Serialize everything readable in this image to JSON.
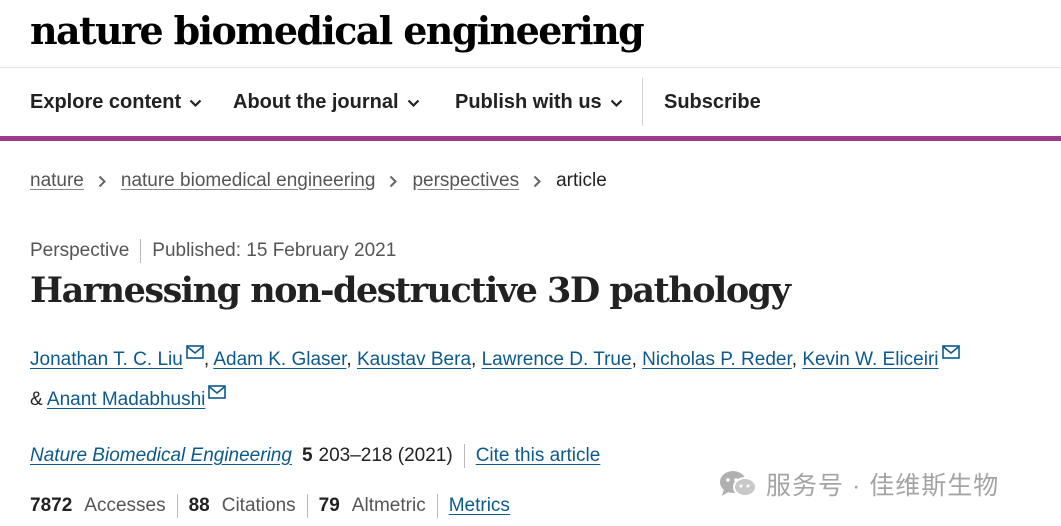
{
  "site": {
    "logo": "nature biomedical engineering"
  },
  "nav": {
    "items": [
      {
        "label": "Explore content"
      },
      {
        "label": "About the journal"
      },
      {
        "label": "Publish with us"
      }
    ],
    "subscribe": "Subscribe"
  },
  "breadcrumb": {
    "links": [
      "nature",
      "nature biomedical engineering",
      "perspectives"
    ],
    "current": "article"
  },
  "article": {
    "type": "Perspective",
    "published": "Published: 15 February 2021",
    "title": "Harnessing non-destructive 3D pathology",
    "authors": [
      "Jonathan T. C. Liu",
      "Adam K. Glaser",
      "Kaustav Bera",
      "Lawrence D. True",
      "Nicholas P. Reder",
      "Kevin W. Eliceiri",
      "Anant Madabhushi"
    ],
    "ampersand": "&",
    "journal": "Nature Biomedical Engineering",
    "volume": "5",
    "pages_year": "203–218 (2021)",
    "cite_label": "Cite this article"
  },
  "metrics": {
    "accesses_count": "7872",
    "accesses_label": "Accesses",
    "citations_count": "88",
    "citations_label": "Citations",
    "altmetric_count": "79",
    "altmetric_label": "Altmetric",
    "metrics_link": "Metrics"
  },
  "watermark": {
    "text": "服务号 · 佳维斯生物"
  },
  "colors": {
    "accent_bar": "#9d3a8e",
    "link": "#0c5a8c",
    "text": "#222222",
    "muted": "#555555"
  }
}
